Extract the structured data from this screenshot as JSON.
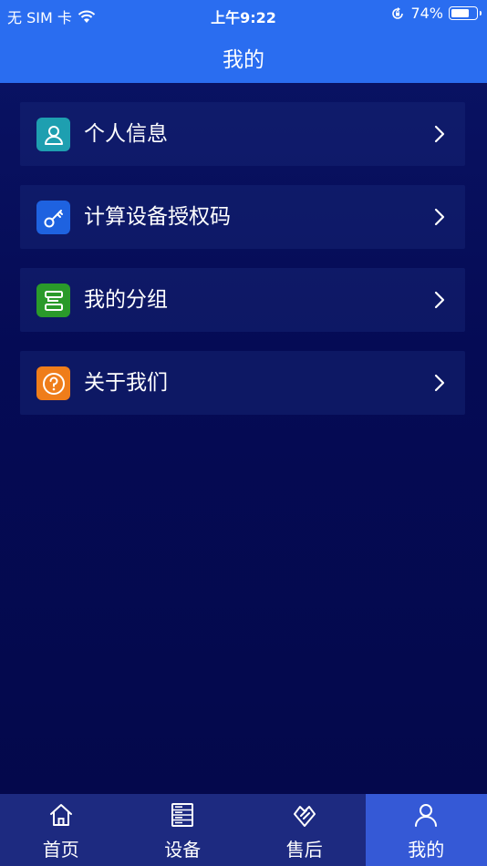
{
  "status_bar": {
    "carrier": "无 SIM 卡",
    "time": "上午9:22",
    "battery_percent": "74%",
    "battery_level": 0.74
  },
  "nav": {
    "title": "我的"
  },
  "menu": {
    "items": [
      {
        "label": "个人信息",
        "icon": "person-icon",
        "color": "#1e9fb0"
      },
      {
        "label": "计算设备授权码",
        "icon": "key-icon",
        "color": "#1e62e0"
      },
      {
        "label": "我的分组",
        "icon": "group-icon",
        "color": "#2a9a2a"
      },
      {
        "label": "关于我们",
        "icon": "question-icon",
        "color": "#ef7d1a"
      }
    ]
  },
  "tabbar": {
    "tabs": [
      {
        "label": "首页",
        "icon": "home-icon"
      },
      {
        "label": "设备",
        "icon": "device-list-icon"
      },
      {
        "label": "售后",
        "icon": "after-sales-icon"
      },
      {
        "label": "我的",
        "icon": "user-icon"
      }
    ],
    "active_index": 3
  },
  "colors": {
    "header": "#2a6df0",
    "background": "#050b55",
    "tab_active": "#3559d6"
  }
}
